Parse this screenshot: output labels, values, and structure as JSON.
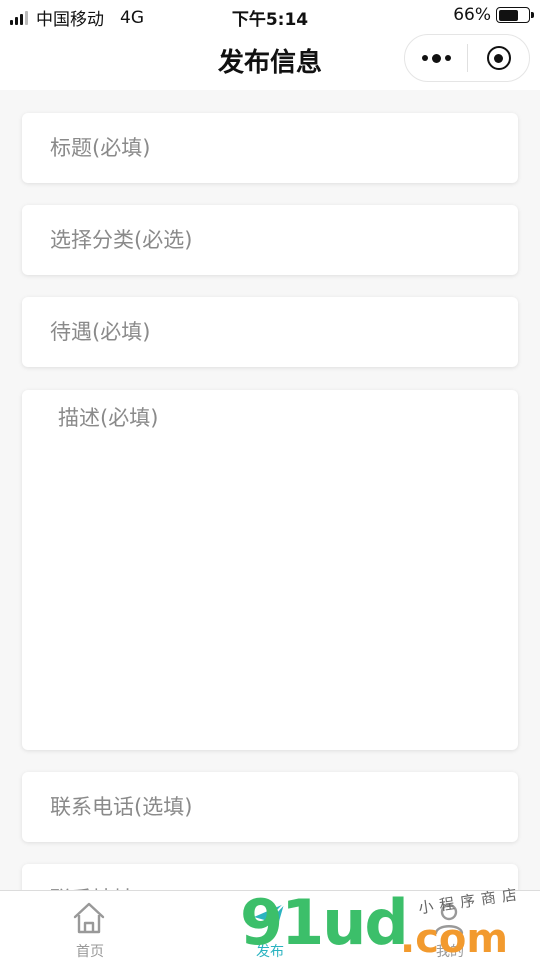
{
  "status_bar": {
    "carrier": "中国移动",
    "network": "4G",
    "time": "下午5:14",
    "battery_text": "66%",
    "battery_level": 0.66
  },
  "nav": {
    "title": "发布信息"
  },
  "form": {
    "title_placeholder": "标题(必填)",
    "category_placeholder": "选择分类(必选)",
    "salary_placeholder": "待遇(必填)",
    "description_placeholder": "描述(必填)",
    "phone_placeholder": "联系电话(选填)",
    "partial_field_text": "联系地址"
  },
  "tabs": [
    {
      "label": "首页",
      "icon": "home-icon"
    },
    {
      "label": "发布",
      "icon": "paper-plane-icon"
    },
    {
      "label": "我的",
      "icon": "user-icon"
    }
  ],
  "watermark": {
    "main": "91ud",
    "dot_com": ".com",
    "sub": "小程序商店"
  },
  "colors": {
    "accent": "#2bb3c0",
    "tab_inactive": "#999999",
    "watermark_green": "#3cbf6a",
    "watermark_orange": "#f29a2e"
  }
}
